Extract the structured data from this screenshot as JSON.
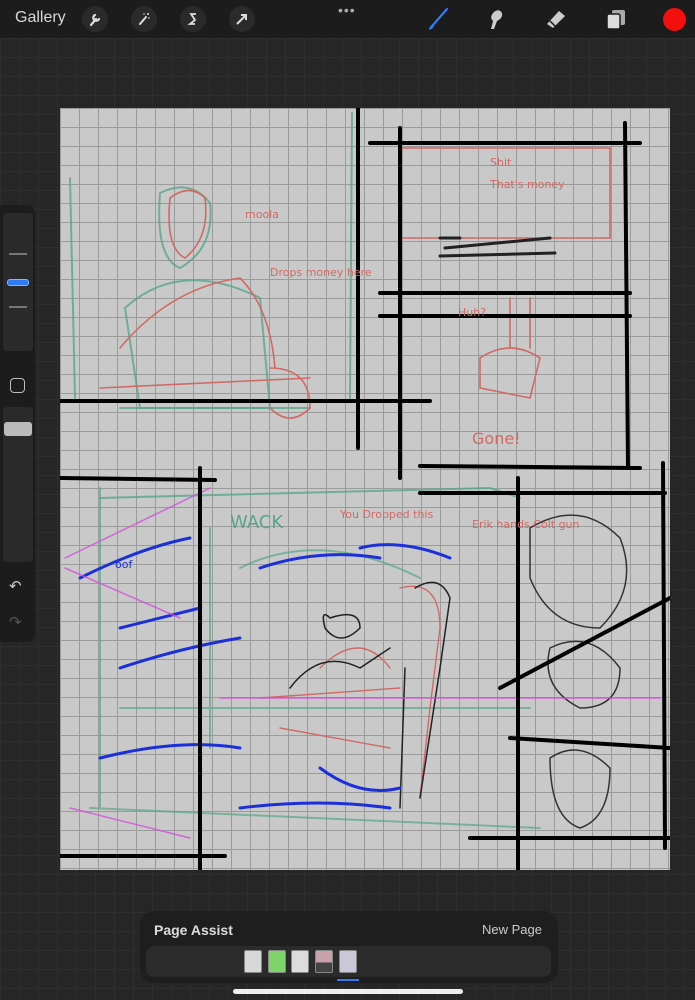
{
  "topbar": {
    "gallery_label": "Gallery",
    "left_tools": [
      "wrench-icon",
      "magic-wand-icon",
      "selection-s-icon",
      "arrow-transform-icon"
    ],
    "more_label": "•••",
    "right_tools": [
      "brush-icon",
      "smudge-icon",
      "eraser-icon",
      "layers-icon"
    ],
    "active_tool": "brush",
    "current_color": "#f40f0f"
  },
  "artwork": {
    "annotations": [
      "moola",
      "Drops money here",
      "Shit",
      "That's money",
      "Huh?",
      "Gone!",
      "You Dropped this",
      "Erik hands Colt gun",
      "oof",
      "WACK"
    ]
  },
  "page_assist": {
    "title": "Page Assist",
    "new_page_label": "New Page",
    "pages": [
      {
        "tint": "#d8d8d8"
      },
      {
        "tint": "#7ed36a"
      },
      {
        "tint": "#dcdcdc"
      },
      {
        "tint": "#a05060"
      },
      {
        "tint": "#c8c8d8"
      }
    ],
    "current_page": 5
  },
  "colors": {
    "accent": "#2f7bf5",
    "panel_bg": "#1c1c1c"
  }
}
